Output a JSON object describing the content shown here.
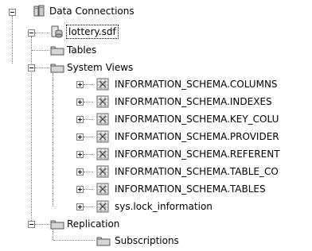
{
  "tree": {
    "root": {
      "label": "Data Connections"
    },
    "connection": {
      "label": "lottery.sdf"
    },
    "tables": {
      "label": "Tables"
    },
    "system_views": {
      "label": "System Views",
      "items": [
        "INFORMATION_SCHEMA.COLUMNS",
        "INFORMATION_SCHEMA.INDEXES",
        "INFORMATION_SCHEMA.KEY_COLU",
        "INFORMATION_SCHEMA.PROVIDER",
        "INFORMATION_SCHEMA.REFERENT",
        "INFORMATION_SCHEMA.TABLE_CO",
        "INFORMATION_SCHEMA.TABLES",
        "sys.lock_information"
      ]
    },
    "replication": {
      "label": "Replication"
    },
    "subscriptions": {
      "label": "Subscriptions"
    }
  },
  "icons": {
    "root": "database-server-icon",
    "connection": "database-file-icon",
    "folder": "folder-icon",
    "view": "view-grid-icon"
  }
}
